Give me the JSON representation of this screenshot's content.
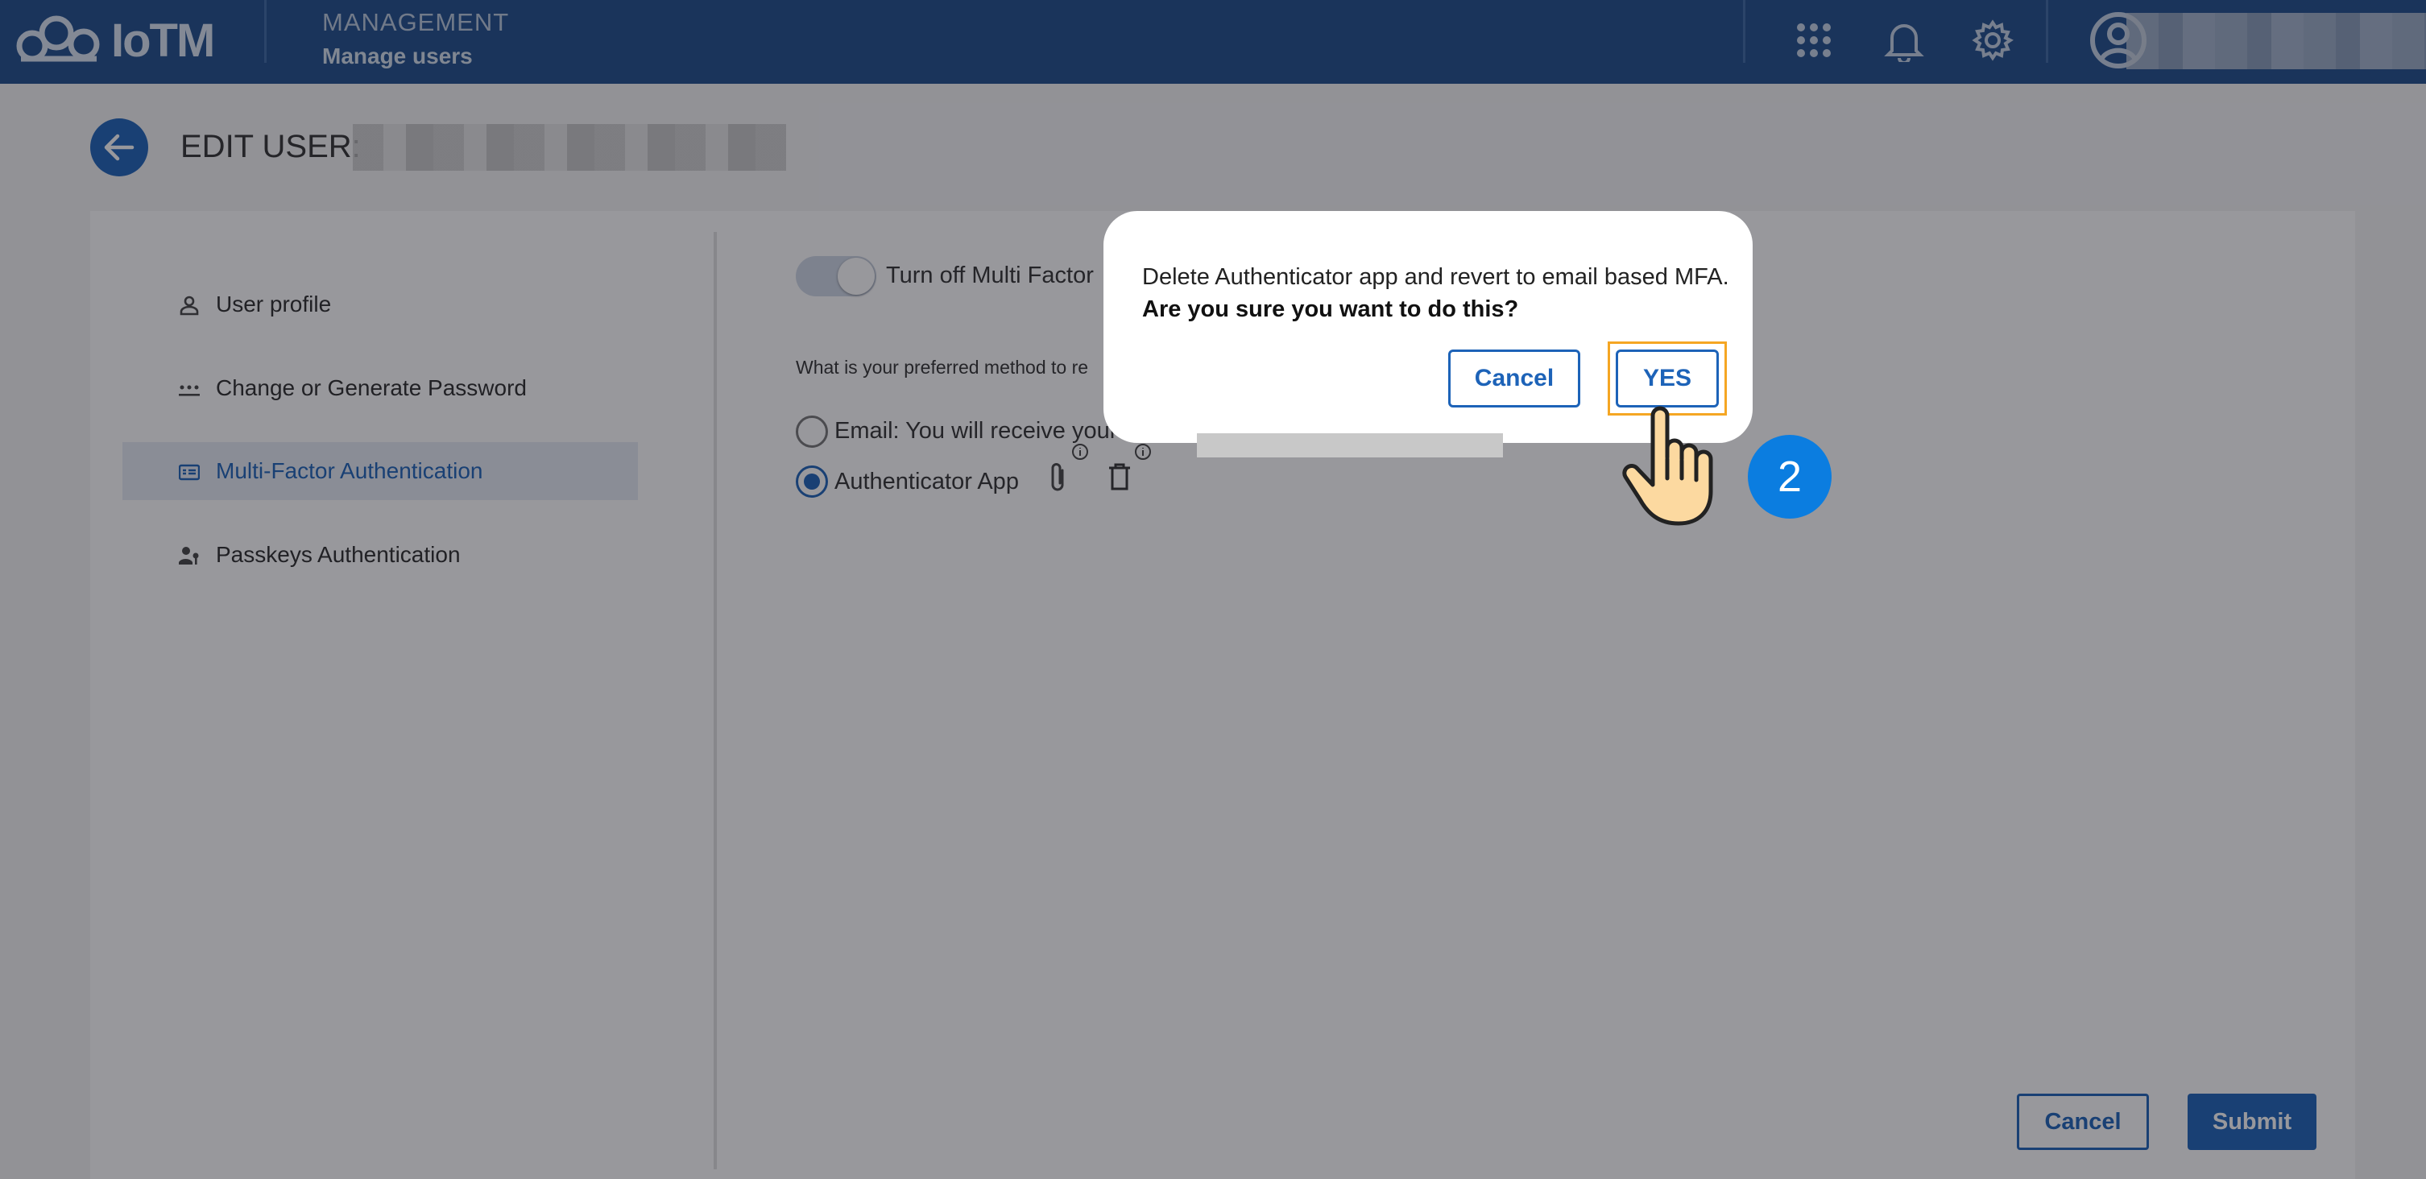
{
  "header": {
    "logo_text": "IoTM",
    "section": "MANAGEMENT",
    "subsection": "Manage users",
    "icons": [
      "apps-grid-icon",
      "bell-icon",
      "gear-icon",
      "account-icon"
    ]
  },
  "page": {
    "title": "EDIT USER:"
  },
  "sidebar": {
    "items": [
      {
        "label": "User profile",
        "icon": "person-icon"
      },
      {
        "label": "Change or Generate Password",
        "icon": "password-icon"
      },
      {
        "label": "Multi-Factor Authentication",
        "icon": "mfa-icon",
        "active": true
      },
      {
        "label": "Passkeys Authentication",
        "icon": "passkey-icon"
      }
    ]
  },
  "mfa": {
    "toggle_label": "Turn off Multi Factor",
    "question": "What is your preferred method to re",
    "options": [
      {
        "label": "Email: You will receive your",
        "checked": false
      },
      {
        "label": "Authenticator App",
        "checked": true
      }
    ]
  },
  "footer": {
    "cancel_label": "Cancel",
    "submit_label": "Submit"
  },
  "dialog": {
    "message": "Delete Authenticator app and revert to email based MFA.",
    "confirm_question": "Are you sure you want to do this?",
    "cancel_label": "Cancel",
    "yes_label": "YES"
  },
  "step_marker": "2",
  "colors": {
    "topbar": "#1f4e8c",
    "primary": "#1d63b8",
    "highlight": "#f5a623",
    "step_badge": "#0b7de0"
  }
}
